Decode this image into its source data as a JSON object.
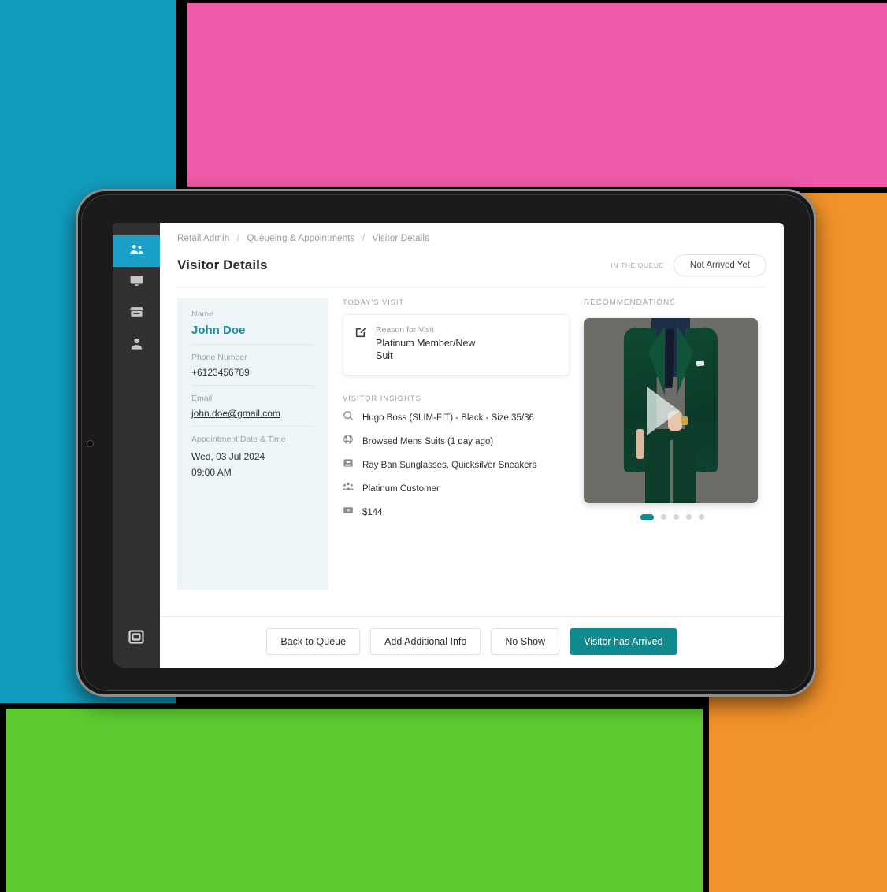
{
  "background": {
    "blocks": [
      {
        "name": "teal",
        "color": "#119dbf"
      },
      {
        "name": "pink",
        "color": "#ee5ba8"
      },
      {
        "name": "orange",
        "color": "#f2922a"
      },
      {
        "name": "green",
        "color": "#5ccb2f"
      }
    ]
  },
  "sidebar": {
    "items": [
      {
        "icon": "people-group-icon",
        "active": true
      },
      {
        "icon": "monitor-icon",
        "active": false
      },
      {
        "icon": "store-icon",
        "active": false
      },
      {
        "icon": "person-icon",
        "active": false
      }
    ],
    "bottom": {
      "icon": "stop-square-icon"
    },
    "active_color": "#1ba0c9"
  },
  "breadcrumb": {
    "items": [
      "Retail Admin",
      "Queueing & Appointments",
      "Visitor Details"
    ],
    "separator": "/"
  },
  "header": {
    "title": "Visitor Details",
    "status_label": "IN THE QUEUE",
    "status_value": "Not Arrived Yet"
  },
  "visitor": {
    "fields": [
      {
        "label": "Name",
        "value": "John Doe",
        "style": "name"
      },
      {
        "label": "Phone Number",
        "value": "+6123456789",
        "style": "plain"
      },
      {
        "label": "Email",
        "value": "john.doe@gmail.com",
        "style": "link"
      },
      {
        "label": "Appointment Date & Time",
        "value": "Wed, 03 Jul 2024",
        "value2": "09:00 AM",
        "style": "stacked"
      }
    ],
    "name_color": "#1a8f9e"
  },
  "todays_visit": {
    "section_title": "TODAY'S VISIT",
    "icon": "edit-square-icon",
    "label": "Reason for Visit",
    "value": "Platinum Member/New Suit"
  },
  "visitor_insights": {
    "section_title": "VISITOR INSIGHTS",
    "rows": [
      {
        "icon": "search-icon",
        "text": "Hugo Boss (SLIM-FIT) - Black - Size 35/36"
      },
      {
        "icon": "globe-icon",
        "text": "Browsed Mens Suits (1 day ago)"
      },
      {
        "icon": "inbox-icon",
        "text": "Ray Ban Sunglasses, Quicksilver Sneakers"
      },
      {
        "icon": "people-group-icon",
        "text": "Platinum Customer"
      },
      {
        "icon": "money-card-icon",
        "text": "$144"
      }
    ]
  },
  "recommendations": {
    "section_title": "RECOMMENDATIONS",
    "media": {
      "icon": "play-icon",
      "description": "Man wearing a dark green suit with navy shirt and tie"
    },
    "carousel": {
      "total": 5,
      "active_index": 0,
      "active_color": "#0f8a90"
    }
  },
  "footer": {
    "buttons": [
      {
        "label": "Back to Queue",
        "primary": false
      },
      {
        "label": "Add Additional Info",
        "primary": false
      },
      {
        "label": "No Show",
        "primary": false
      },
      {
        "label": "Visitor has Arrived",
        "primary": true
      }
    ],
    "primary_color": "#0f8a8e"
  }
}
